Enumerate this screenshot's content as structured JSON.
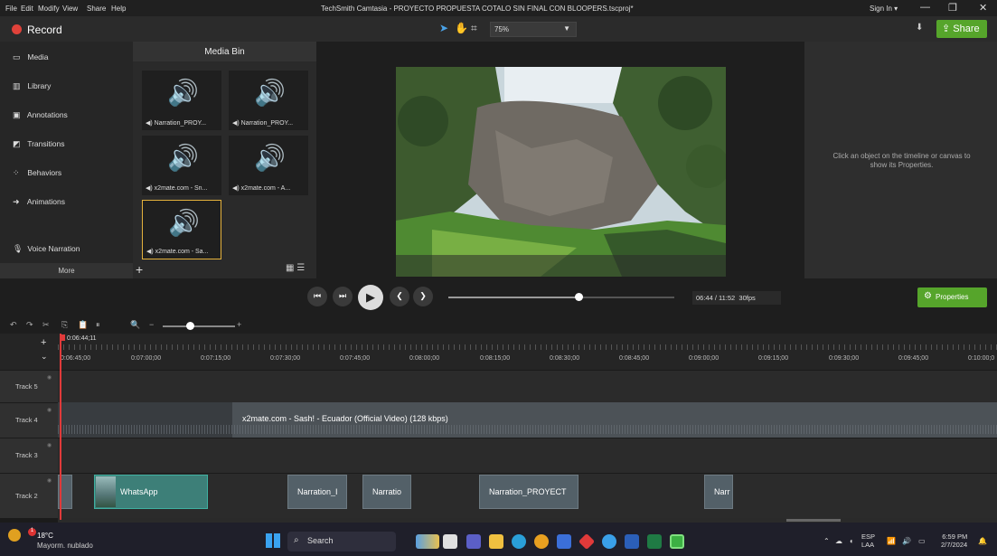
{
  "menu": [
    "File",
    "Edit",
    "Modify",
    "View",
    "Share",
    "Help"
  ],
  "window_title": "TechSmith Camtasia - PROYECTO PROPUESTA COTALO SIN FINAL CON BLOOPERS.tscproj*",
  "sign_in": "Sign In ▾",
  "record_label": "Record",
  "zoom_level": "75%",
  "share_label": "Share",
  "nav": {
    "items": [
      "Media",
      "Library",
      "Annotations",
      "Transitions",
      "Behaviors",
      "Animations",
      "Voice Narration"
    ],
    "more": "More"
  },
  "media_bin": {
    "title": "Media Bin",
    "items": [
      "Narration_PROY...",
      "Narration_PROY...",
      "x2mate.com - Sn...",
      "x2mate.com - A...",
      "x2mate.com - Sa..."
    ]
  },
  "properties_hint": "Click an object on the timeline or canvas to show its Properties.",
  "playback": {
    "time": "06:44 / 11:52",
    "fps": "30fps",
    "properties_label": "Properties"
  },
  "timeline": {
    "playhead_time": "0:06:44;11",
    "ruler": [
      "0:06:45;00",
      "0:07:00;00",
      "0:07:15;00",
      "0:07:30;00",
      "0:07:45;00",
      "0:08:00;00",
      "0:08:15;00",
      "0:08:30;00",
      "0:08:45;00",
      "0:09:00;00",
      "0:09:15;00",
      "0:09:30;00",
      "0:09:45;00",
      "0:10:00;0"
    ],
    "tracks": [
      "Track 5",
      "Track 4",
      "Track 3",
      "Track 2"
    ],
    "track4_clip": "x2mate.com - Sash! - Ecuador (Official Video) (128 kbps)",
    "track2_clips": [
      "WhatsApp",
      "Narration_I",
      "Narratio",
      "Narration_PROYECT",
      "Narr"
    ]
  },
  "taskbar": {
    "temperature": "18°C",
    "weather": "Mayorm. nublado",
    "search": "Search",
    "lang_line1": "ESP",
    "lang_line2": "LAA",
    "time": "6:59 PM",
    "date": "2/7/2024"
  },
  "colors": {
    "accent": "#56a52b",
    "record": "#e0423a",
    "playhead": "#e03a3a",
    "selected_border": "#e4b13c"
  }
}
